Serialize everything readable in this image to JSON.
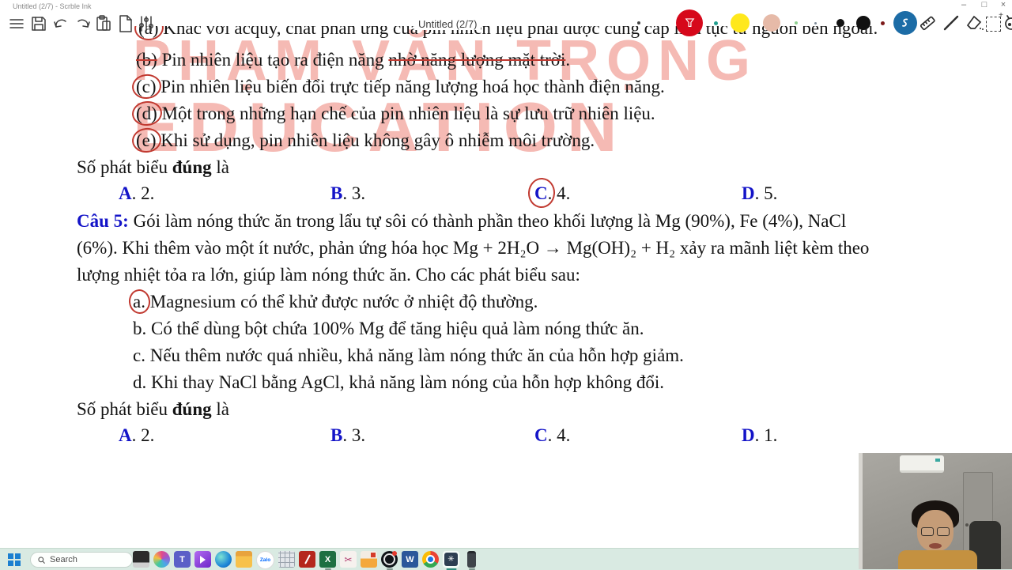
{
  "window": {
    "titlebar_text": "Untitled (2/7) - Scrble Ink",
    "center_title": "Untitled (2/7)",
    "minimize": "–",
    "restore": "□",
    "close": "×"
  },
  "palette": {
    "selected_red": "#d6081b",
    "teal": "#1f9e8e",
    "yellow": "#ffe81c",
    "pink": "#e6baa8",
    "green": "#8fcf90",
    "gray": "#7f8c99",
    "black": "#111111",
    "maroon": "#7c1a1a",
    "brand_blue": "#1c6ca6"
  },
  "watermark": {
    "line1": "PHẠM VĂN TRỌNG",
    "line2": "EDUCATION"
  },
  "q4": {
    "a_prefix": "(a)",
    "a_text": " Khác với acquy, chất phản ứng của pin nhiên liệu phải được cung cấp liên tục từ nguồn bên ngoài.",
    "b_prefix": "(b)",
    "b_t1": " Pin nhiên liệu tạo ra điện năng ",
    "b_struck": "nhờ năng lượng mặt trời",
    "b_end": ".",
    "c_prefix": "(c)",
    "c_text": " Pin nhiên liệu biến đổi trực tiếp năng lượng hoá học thành điện năng.",
    "d_prefix": "(d)",
    "d_text": " Một trong những hạn chế của pin nhiên liệu là sự lưu trữ nhiên liệu.",
    "e_prefix": "(e)",
    "e_text": " Khi sử dụng, pin nhiên liệu không gây ô nhiễm môi trường.",
    "summary_prefix": "Số phát biểu ",
    "summary_bold": "đúng",
    "summary_suffix": " là",
    "answers": [
      {
        "letter": "A",
        "rest": ". 2."
      },
      {
        "letter": "B",
        "rest": ". 3."
      },
      {
        "letter": "C",
        "rest": ". 4."
      },
      {
        "letter": "D",
        "rest": ". 5."
      }
    ]
  },
  "q5": {
    "line1_label": "Câu 5:",
    "line1_text": " Gói làm nóng thức ăn trong lẩu tự sôi có thành phần theo khối lượng là Mg (90%), Fe (4%), NaCl",
    "line2": "(6%). Khi thêm vào một ít nước, phản ứng hóa học Mg + 2H₂O → Mg(OH)₂ + H₂ xảy ra mãnh liệt kèm theo",
    "line3": "lượng nhiệt tỏa ra lớn, giúp làm nóng thức ăn. Cho các phát biểu sau:",
    "a_prefix": "a.",
    "a_text": " Magnesium có thể khử được nước ở nhiệt độ thường.",
    "b_prefix": "b.",
    "b_text": " Có thể dùng bột chứa 100% Mg để tăng hiệu quả làm nóng thức ăn.",
    "c_prefix": "c.",
    "c_text": " Nếu thêm nước quá nhiều, khả năng làm nóng thức ăn của hỗn hợp giảm.",
    "d_prefix": "d.",
    "d_text": " Khi thay NaCl bằng AgCl, khả năng làm nóng của hỗn hợp không đổi.",
    "summary_prefix": "Số phát biểu ",
    "summary_bold": "đúng",
    "summary_suffix": " là",
    "answers": [
      {
        "letter": "A",
        "rest": ". 2."
      },
      {
        "letter": "B",
        "rest": ". 3."
      },
      {
        "letter": "C",
        "rest": ". 4."
      },
      {
        "letter": "D",
        "rest": ". 1."
      }
    ]
  },
  "taskbar": {
    "search_placeholder": "Search",
    "teams_glyph": "T",
    "word_glyph": "W",
    "excel_glyph": "X",
    "zalo_label": "Zalo",
    "scrble_glyph": "✳",
    "snip_glyph": "✂"
  }
}
